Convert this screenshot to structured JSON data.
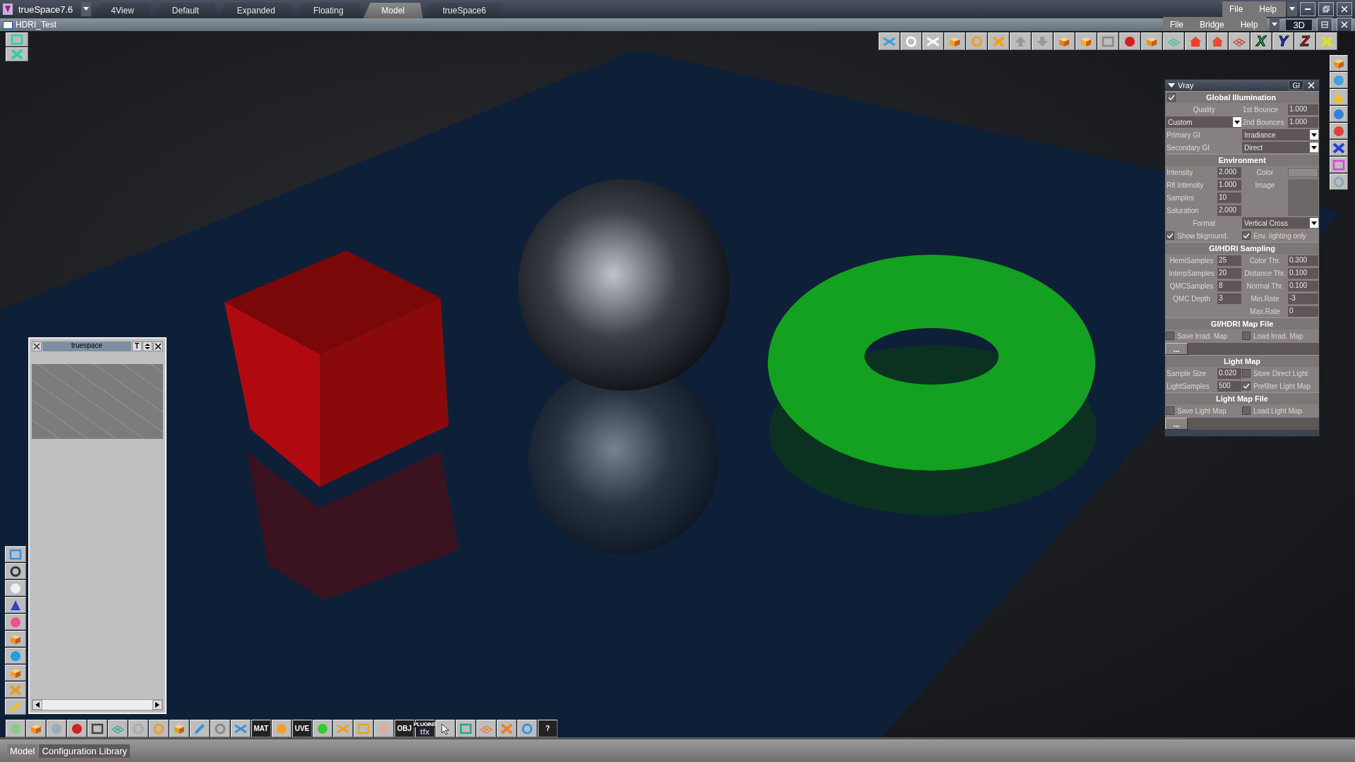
{
  "app": {
    "title": "trueSpace7.6",
    "tabs": [
      {
        "label": "4View",
        "selected": false
      },
      {
        "label": "Default",
        "selected": false
      },
      {
        "label": "Expanded",
        "selected": false
      },
      {
        "label": "Floating",
        "selected": false
      },
      {
        "label": "Model",
        "selected": true
      },
      {
        "label": "trueSpace6",
        "selected": false
      }
    ],
    "menu": [
      "File",
      "Help"
    ]
  },
  "document": {
    "title": "HDRI_Test",
    "menu": [
      "File",
      "Bridge",
      "Help"
    ],
    "view_mode": "3D"
  },
  "axis_buttons": [
    "X",
    "Y",
    "Z"
  ],
  "vray": {
    "title": "Vray",
    "tab": "GI",
    "sections": [
      {
        "title": "Global Illumination",
        "enabled": true,
        "rows": [
          {
            "left": [
              {
                "kind": "caption",
                "text": "Quality"
              }
            ],
            "right": [
              {
                "kind": "label",
                "text": "1st Bounce"
              },
              {
                "kind": "field",
                "text": "1.000"
              }
            ]
          },
          {
            "left": [
              {
                "kind": "dropdown",
                "text": "Custom"
              }
            ],
            "right": [
              {
                "kind": "label",
                "text": "2nd Bounces"
              },
              {
                "kind": "field",
                "text": "1.000"
              }
            ]
          },
          {
            "left": [
              {
                "kind": "label",
                "text": "Primary GI"
              }
            ],
            "right": [
              {
                "kind": "dropdown",
                "text": "Irradiance"
              }
            ]
          },
          {
            "left": [
              {
                "kind": "label",
                "text": "Secondary GI"
              }
            ],
            "right": [
              {
                "kind": "dropdown",
                "text": "Direct"
              }
            ]
          }
        ]
      },
      {
        "title": "Environment",
        "rows": [
          {
            "left": [
              {
                "kind": "label",
                "text": "Intensity"
              },
              {
                "kind": "field",
                "text": "2.000"
              }
            ],
            "right": [
              {
                "kind": "caption",
                "text": "Color"
              },
              {
                "kind": "swatch"
              }
            ]
          },
          {
            "left": [
              {
                "kind": "label",
                "text": "Rfl Intensity"
              },
              {
                "kind": "field",
                "text": "1.000"
              }
            ],
            "right": [
              {
                "kind": "caption",
                "text": "Image"
              },
              {
                "kind": "image"
              }
            ]
          },
          {
            "left": [
              {
                "kind": "label",
                "text": "Samples"
              },
              {
                "kind": "field",
                "text": "10"
              }
            ]
          },
          {
            "left": [
              {
                "kind": "label",
                "text": "Saturation"
              },
              {
                "kind": "field",
                "text": "2.000"
              }
            ]
          },
          {
            "left": [
              {
                "kind": "caption",
                "text": "Format"
              }
            ],
            "right": [
              {
                "kind": "dropdown",
                "text": "Vertical Cross"
              }
            ]
          },
          {
            "left": [
              {
                "kind": "check",
                "text": "Show bkground.",
                "checked": true
              }
            ],
            "right": [
              {
                "kind": "check",
                "text": "Env. lighting only",
                "checked": true
              }
            ]
          }
        ]
      },
      {
        "title": "GI/HDRI Sampling",
        "rows": [
          {
            "left": [
              {
                "kind": "caption",
                "text": "HemiSamples"
              },
              {
                "kind": "field",
                "text": "25"
              }
            ],
            "right": [
              {
                "kind": "caption",
                "text": "Color Thr."
              },
              {
                "kind": "field",
                "text": "0.300"
              }
            ]
          },
          {
            "left": [
              {
                "kind": "caption",
                "text": "InterpSamples"
              },
              {
                "kind": "field",
                "text": "20"
              }
            ],
            "right": [
              {
                "kind": "caption",
                "text": "Distance Thr."
              },
              {
                "kind": "field",
                "text": "0.100"
              }
            ]
          },
          {
            "left": [
              {
                "kind": "caption",
                "text": "QMCSamples"
              },
              {
                "kind": "field",
                "text": "8"
              }
            ],
            "right": [
              {
                "kind": "caption",
                "text": "Normal Thr."
              },
              {
                "kind": "field",
                "text": "0.100"
              }
            ]
          },
          {
            "left": [
              {
                "kind": "caption",
                "text": "QMC Depth"
              },
              {
                "kind": "field",
                "text": "3"
              }
            ],
            "right": [
              {
                "kind": "caption",
                "text": "Min.Rate"
              },
              {
                "kind": "field",
                "text": "-3"
              }
            ]
          },
          {
            "right": [
              {
                "kind": "caption",
                "text": "Max.Rate"
              },
              {
                "kind": "field",
                "text": "0"
              }
            ]
          }
        ]
      },
      {
        "title": "GI/HDRI Map File",
        "rows": [
          {
            "left": [
              {
                "kind": "check",
                "text": "Save Irrad. Map",
                "checked": false
              }
            ],
            "right": [
              {
                "kind": "check",
                "text": "Load Irrad. Map",
                "checked": false
              }
            ]
          },
          {
            "browse": "..."
          }
        ]
      },
      {
        "title": "Light Map",
        "rows": [
          {
            "left": [
              {
                "kind": "label",
                "text": "Sample Size"
              },
              {
                "kind": "field",
                "text": "0.020"
              }
            ],
            "right": [
              {
                "kind": "check",
                "text": "Store Direct Light",
                "checked": false
              }
            ]
          },
          {
            "left": [
              {
                "kind": "label",
                "text": "LightSamples"
              },
              {
                "kind": "field",
                "text": "500"
              }
            ],
            "right": [
              {
                "kind": "check",
                "text": "Prefilter Light Map",
                "checked": true
              }
            ]
          }
        ]
      },
      {
        "title": "Light Map File",
        "rows": [
          {
            "left": [
              {
                "kind": "check",
                "text": "Save Light Map",
                "checked": false
              }
            ],
            "right": [
              {
                "kind": "check",
                "text": "Load Light Map",
                "checked": false
              }
            ]
          },
          {
            "browse": "..."
          }
        ]
      }
    ]
  },
  "preview_window": {
    "title": "truespace",
    "button": "T"
  },
  "bottom_toolbar": {
    "text_icons": [
      {
        "text": "MAT"
      },
      {
        "text": "UVE"
      },
      {
        "text": "OBJ"
      },
      {
        "text": "tfx",
        "caption": "PLUGINS"
      },
      {
        "text": "?"
      }
    ]
  },
  "status_bar": {
    "tabs": [
      {
        "label": "Model",
        "selected": false
      },
      {
        "label": "Configuration Library",
        "selected": true
      }
    ]
  }
}
